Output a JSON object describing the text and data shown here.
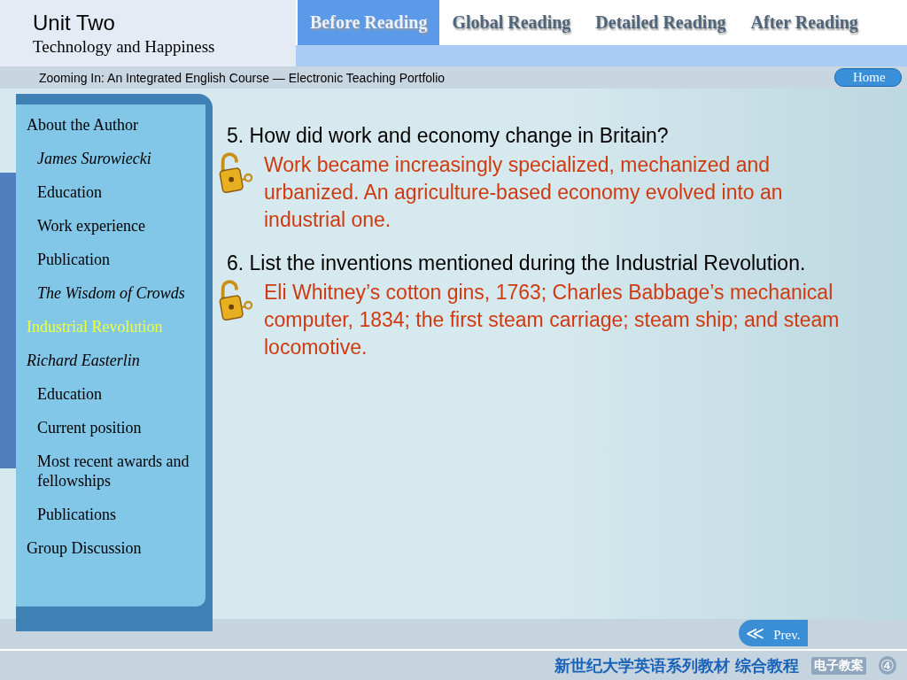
{
  "header": {
    "unit": "Unit Two",
    "title": "Technology and Happiness"
  },
  "tabs": [
    {
      "label": "Before Reading",
      "selected": true
    },
    {
      "label": "Global Reading",
      "selected": false
    },
    {
      "label": "Detailed Reading",
      "selected": false
    },
    {
      "label": "After Reading",
      "selected": false
    }
  ],
  "subbar": {
    "course": "Zooming In: An Integrated English Course — Electronic Teaching Portfolio",
    "home": "Home"
  },
  "sidebar": {
    "items": [
      {
        "label": "About the Author",
        "italic": false,
        "selected": false,
        "children": [
          {
            "label": "James Surowiecki",
            "italic": true,
            "selected": false
          },
          {
            "label": "Education",
            "italic": false,
            "selected": false
          },
          {
            "label": "Work experience",
            "italic": false,
            "selected": false
          },
          {
            "label": "Publication",
            "italic": false,
            "selected": false
          },
          {
            "label": "The Wisdom of Crowds",
            "italic": true,
            "selected": false
          }
        ]
      },
      {
        "label": "Industrial Revolution",
        "italic": false,
        "selected": true
      },
      {
        "label": "Richard Easterlin",
        "italic": true,
        "selected": false,
        "children": [
          {
            "label": "Education",
            "italic": false,
            "selected": false
          },
          {
            "label": "Current position",
            "italic": false,
            "selected": false
          },
          {
            "label": "Most recent awards and fellowships",
            "italic": false,
            "selected": false
          },
          {
            "label": "Publications",
            "italic": false,
            "selected": false
          }
        ]
      },
      {
        "label": "Group Discussion",
        "italic": false,
        "selected": false
      }
    ]
  },
  "questions": [
    {
      "question": "5. How did work and economy change in Britain?",
      "answer": "Work became increasingly specialized, mechanized and urbanized. An agriculture-based economy evolved into an industrial one."
    },
    {
      "question": "6. List the inventions mentioned during the Industrial Revolution.",
      "answer": "Eli Whitney’s cotton gins, 1763; Charles Babbage’s mechanical computer, 1834; the first steam carriage; steam ship; and steam locomotive."
    }
  ],
  "prev": {
    "arrow": "≪",
    "label": "Prev."
  },
  "footer": {
    "series": "新世纪大学英语系列教材 综合教程",
    "subtitle": "电子教案",
    "page": "④"
  }
}
